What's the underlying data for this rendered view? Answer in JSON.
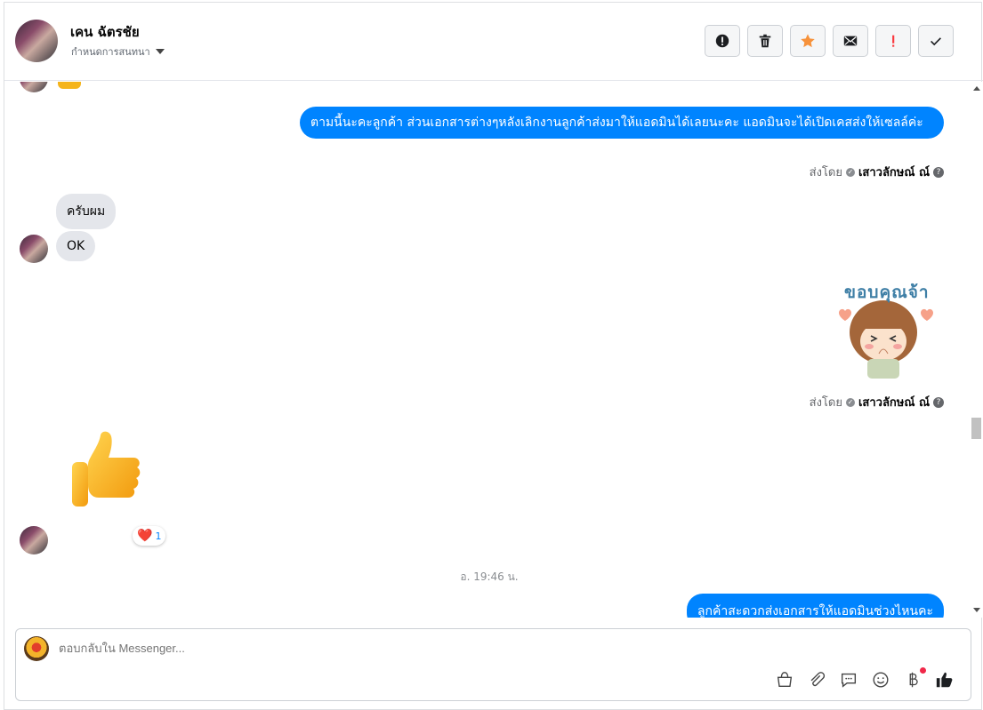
{
  "header": {
    "contact_name": "เคน ฉัตรชัย",
    "assign_label": "กำหนดการสนทนา",
    "toolbar": [
      "report-spam-icon",
      "trash-icon",
      "star-icon",
      "envelope-icon",
      "exclamation-icon",
      "check-icon"
    ],
    "colors": {
      "star": "#f7923b",
      "exclamation": "#fa383e"
    }
  },
  "thread": {
    "messages": [
      {
        "from": "page",
        "text": "ตามนี้นะคะลูกค้า ส่วนเอกสารต่างๆหลังเลิกงานลูกค้าส่งมาให้แอดมินได้เลยนะคะ แอดมินจะได้เปิดเคสส่งให้เซลล์ค่ะ"
      },
      {
        "from": "customer",
        "text": "ครับผม"
      },
      {
        "from": "customer",
        "text": "OK"
      },
      {
        "from": "page",
        "sticker_text": "ขอบคุณจ้า"
      },
      {
        "from": "customer",
        "sticker": "thumbs-up"
      },
      {
        "from": "page",
        "text": "ลูกค้าสะดวกส่งเอกสารให้แอดมินช่วงไหนคะ"
      }
    ],
    "sent_by_prefix": "ส่งโดย",
    "sent_by_name": "เสาวลักษณ์ ณ์",
    "reaction": {
      "emoji": "❤️",
      "count": "1"
    },
    "timestamp": "อ. 19:46 น."
  },
  "composer": {
    "placeholder": "ตอบกลับใน Messenger...",
    "icons": [
      "shopping-bag-icon",
      "paperclip-icon",
      "saved-reply-icon",
      "emoji-icon",
      "baht-icon",
      "like-icon"
    ]
  },
  "colors": {
    "outgoing_bubble": "#0084ff",
    "incoming_bubble": "#e4e6eb"
  }
}
